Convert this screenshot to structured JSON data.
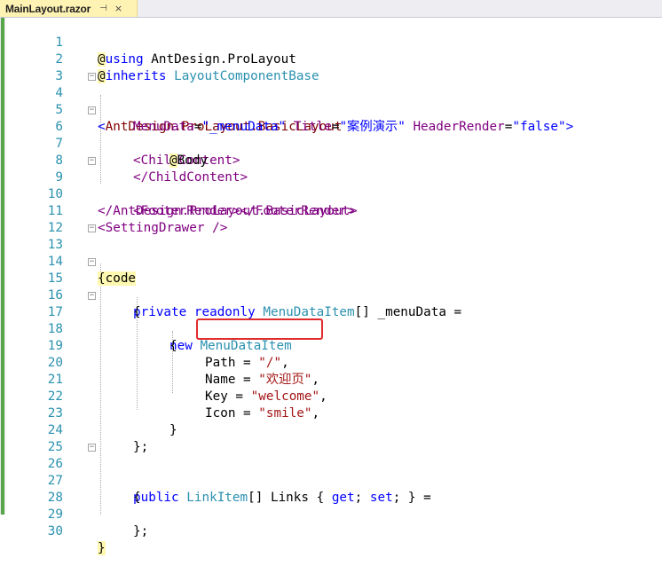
{
  "tab": {
    "title": "MainLayout.razor",
    "pin": "⊣",
    "close": "×"
  },
  "lines": [
    {
      "n": "1"
    },
    {
      "n": "2"
    },
    {
      "n": "3"
    },
    {
      "n": "4"
    },
    {
      "n": "5"
    },
    {
      "n": "6"
    },
    {
      "n": "7"
    },
    {
      "n": "8"
    },
    {
      "n": "9"
    },
    {
      "n": "10"
    },
    {
      "n": "11"
    },
    {
      "n": "12"
    },
    {
      "n": "13"
    },
    {
      "n": "14"
    },
    {
      "n": "15"
    },
    {
      "n": "16"
    },
    {
      "n": "17"
    },
    {
      "n": "18"
    },
    {
      "n": "19"
    },
    {
      "n": "20"
    },
    {
      "n": "21"
    },
    {
      "n": "22"
    },
    {
      "n": "23"
    },
    {
      "n": "24"
    },
    {
      "n": "25"
    },
    {
      "n": "26"
    },
    {
      "n": "27"
    },
    {
      "n": "28"
    },
    {
      "n": "29"
    },
    {
      "n": "30"
    }
  ],
  "code": {
    "l1": {
      "at": "@",
      "kw": "using",
      "rest": " AntDesign.ProLayout"
    },
    "l2": {
      "at": "@",
      "kw": "inherits",
      "type": "LayoutComponentBase"
    },
    "l4": {
      "open": "<",
      "tag": "AntDesign.ProLayout.BasicLayout"
    },
    "l5": {
      "a1": "MenuData",
      "v1": "\"_menuData\"",
      "a2": "Title",
      "v2": "\"案例演示\"",
      "a3": "HeaderRender",
      "v3": "\"false\"",
      "close": ">"
    },
    "l6": {
      "tag": "<ChildContent>"
    },
    "l7": {
      "at": "@",
      "word": "Body"
    },
    "l8": {
      "tag": "</ChildContent>"
    },
    "l9": {
      "tag": "<FooterRender></FooterRender>"
    },
    "l10": {
      "tag": "</AntDesign.ProLayout.BasicLayout>"
    },
    "l11": {
      "tag": "<SettingDrawer />"
    },
    "l13": {
      "at": "@",
      "kw": "code"
    },
    "l14": {
      "text": "{"
    },
    "l15": {
      "k1": "private",
      "k2": "readonly",
      "type": "MenuDataItem",
      "rest": "[] _menuData ="
    },
    "l16": {
      "text": "{"
    },
    "l17": {
      "kw": "new",
      "type": "MenuDataItem"
    },
    "l18": {
      "text": "{"
    },
    "l19": {
      "name": "Path",
      "eq": " = ",
      "val": "\"/\"",
      "comma": ","
    },
    "l20": {
      "name": "Name",
      "eq": " = ",
      "val": "\"欢迎页\"",
      "comma": ","
    },
    "l21": {
      "name": "Key",
      "eq": " = ",
      "val": "\"welcome\"",
      "comma": ","
    },
    "l22": {
      "name": "Icon",
      "eq": " = ",
      "val": "\"smile\"",
      "comma": ","
    },
    "l23": {
      "text": "}"
    },
    "l24": {
      "text": "};"
    },
    "l26": {
      "kw": "public",
      "type": "LinkItem",
      "mid": "[] Links { ",
      "g": "get",
      "sc": "; ",
      "s": "set",
      "end": "; } ="
    },
    "l27": {
      "text": "{"
    },
    "l29": {
      "text": "};"
    },
    "l30": {
      "text": "}"
    }
  },
  "colors": {
    "razor_bg": "#fff9b0",
    "line_number": "#2b91af",
    "keyword": "#0000ff",
    "tag": "#800000",
    "string": "#a31515",
    "highlight_box": "#e02c2c",
    "tab_bg": "#fff3b4"
  }
}
